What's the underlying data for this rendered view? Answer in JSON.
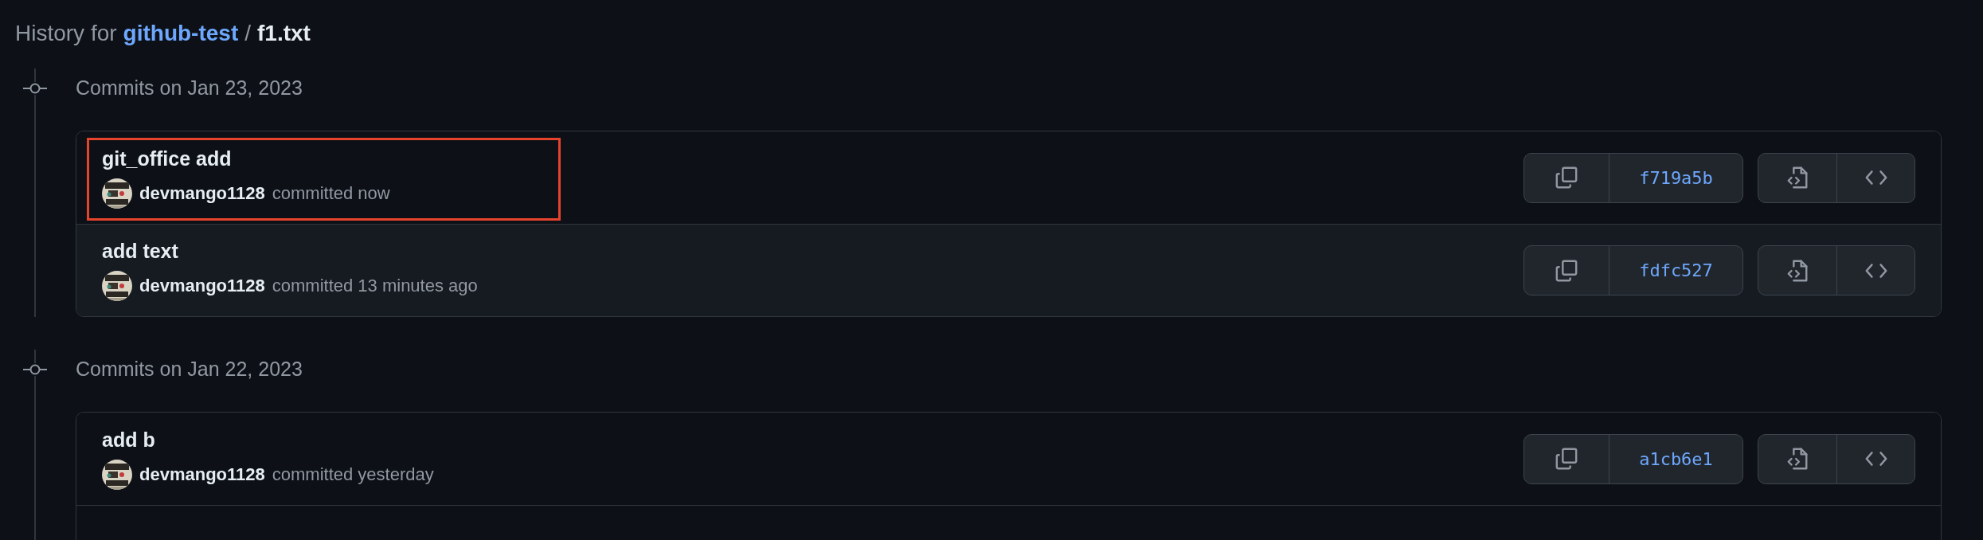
{
  "heading": {
    "prefix": "History for",
    "repo": "github-test",
    "separator": "/",
    "file": "f1.txt"
  },
  "groups": [
    {
      "date_label": "Commits on Jan 23, 2023",
      "commits": [
        {
          "message": "git_office add",
          "author": "devmango1128",
          "time_text": "committed now",
          "sha": "f719a5b",
          "highlighted": true,
          "hovered": false
        },
        {
          "message": "add text",
          "author": "devmango1128",
          "time_text": "committed 13 minutes ago",
          "sha": "fdfc527",
          "highlighted": false,
          "hovered": true
        }
      ]
    },
    {
      "date_label": "Commits on Jan 22, 2023",
      "commits": [
        {
          "message": "add b",
          "author": "devmango1128",
          "time_text": "committed yesterday",
          "sha": "a1cb6e1",
          "highlighted": false,
          "hovered": false
        }
      ]
    }
  ]
}
